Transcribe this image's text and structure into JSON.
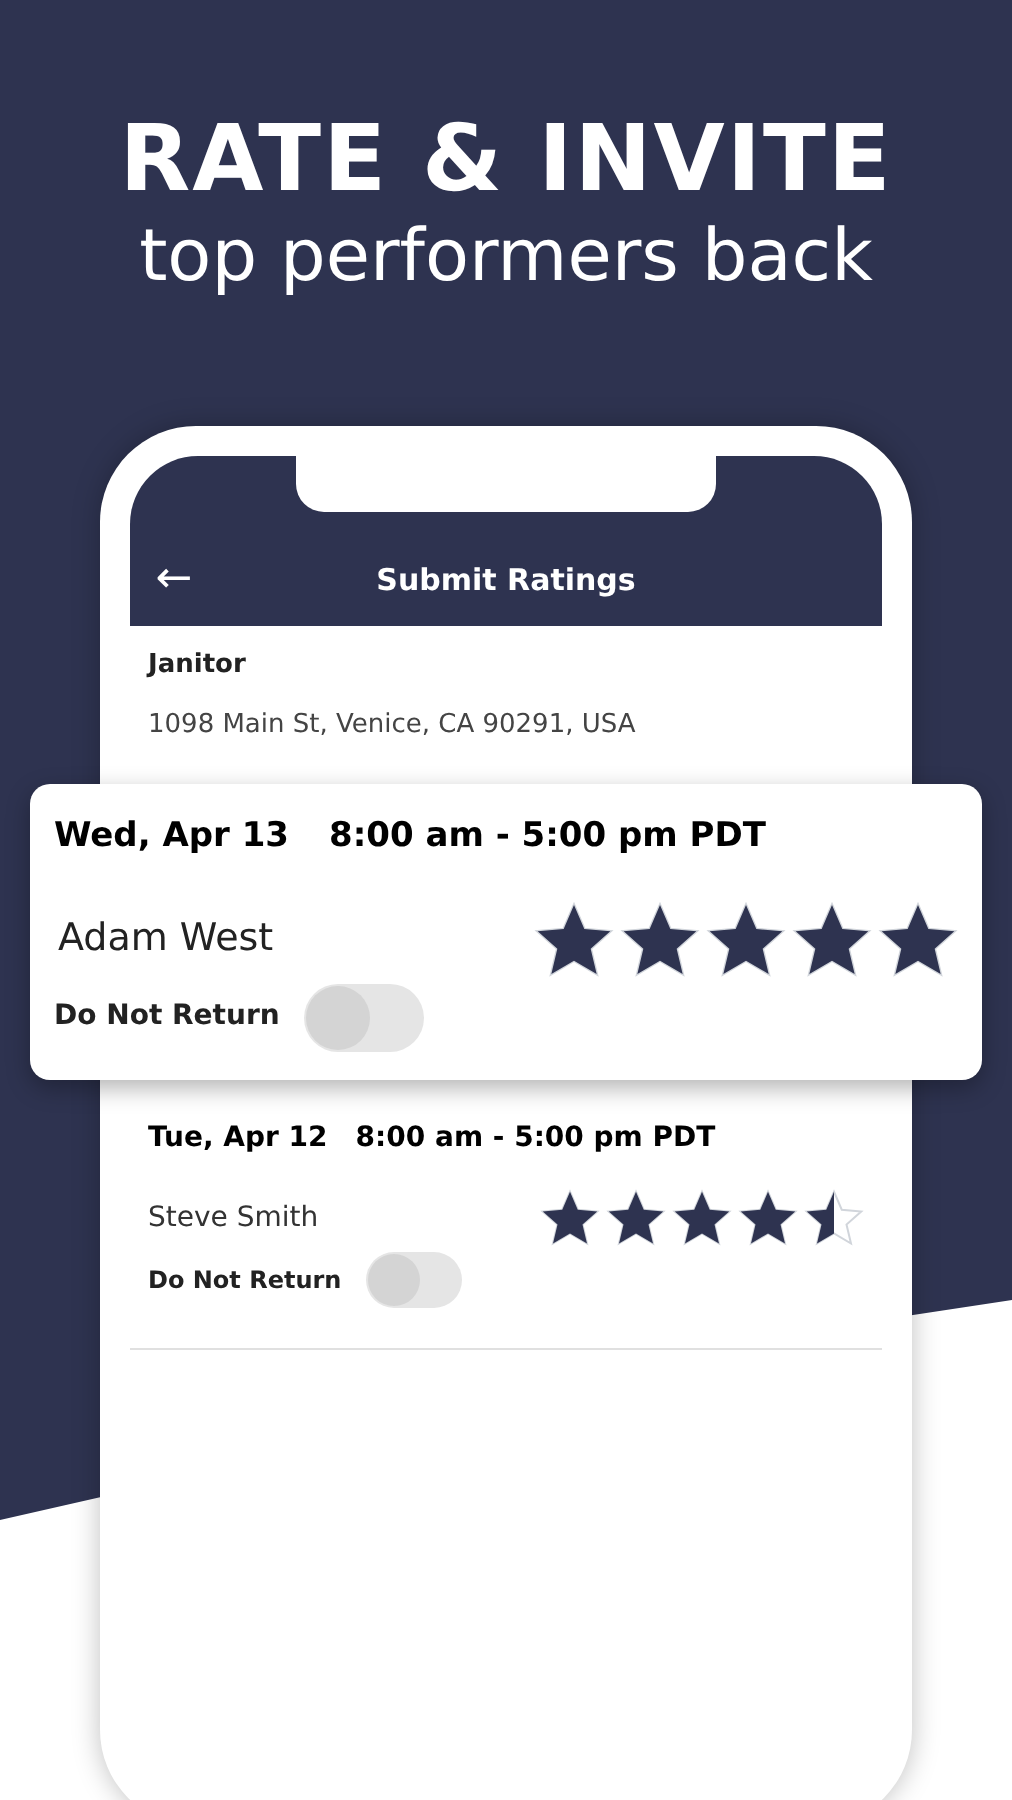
{
  "headline": {
    "title": "RATE & INVITE",
    "subtitle": "top performers back"
  },
  "app_bar": {
    "back": "←",
    "title": "Submit Ratings"
  },
  "job": {
    "title": "Janitor",
    "address": "1098 Main St, Venice, CA 90291, USA"
  },
  "shifts": [
    {
      "date": "Wed, Apr 13",
      "time": "8:00 am - 5:00 pm PDT",
      "worker": "Adam West",
      "stars": 5,
      "do_not_return": {
        "label": "Do Not Return",
        "on": false
      },
      "highlighted": true
    },
    {
      "date": "Tue, Apr 12",
      "time": "8:00 am - 5:00 pm PDT",
      "worker": "Steve Smith",
      "stars": 4.5,
      "do_not_return": {
        "label": "Do Not Return",
        "on": false
      },
      "highlighted": false
    }
  ]
}
